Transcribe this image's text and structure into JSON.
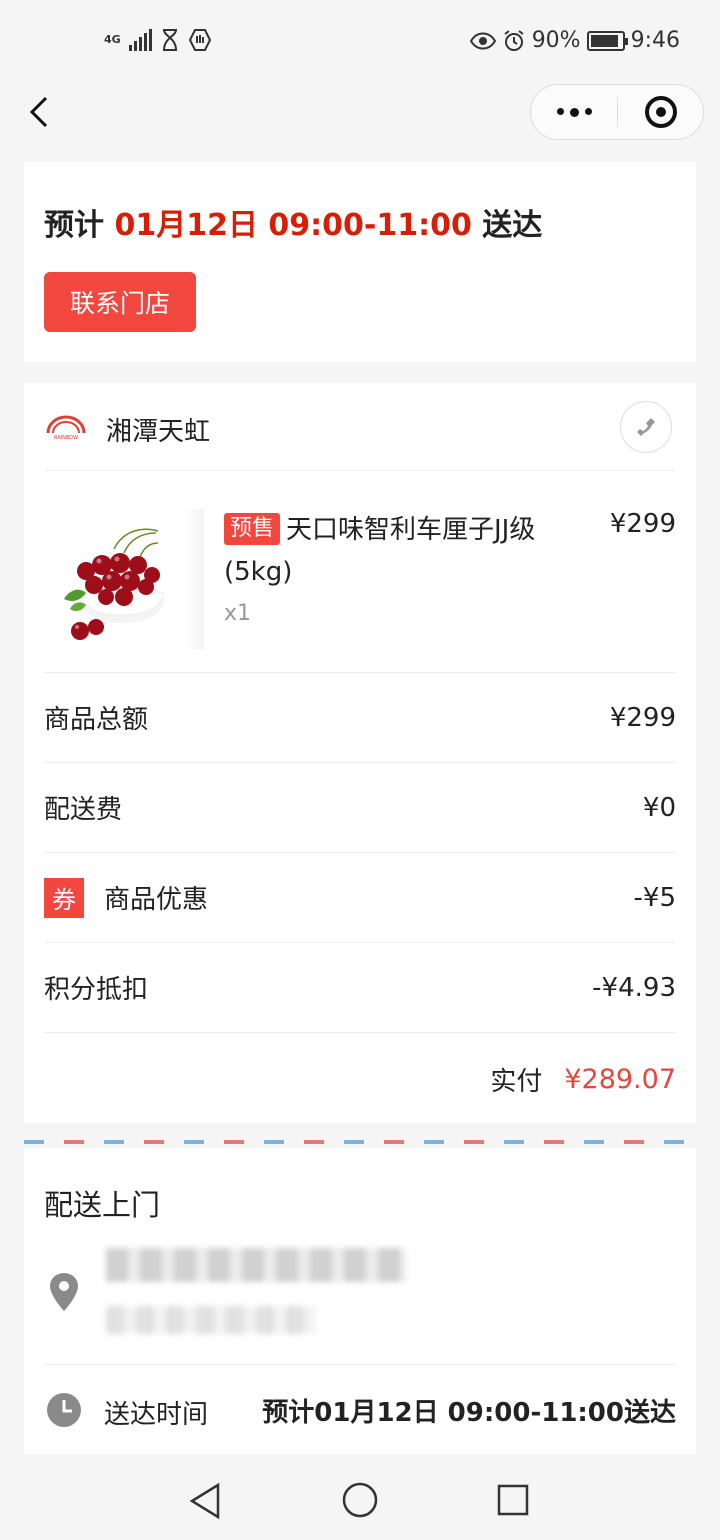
{
  "status": {
    "network": "4G",
    "battery": "90%",
    "time": "9:46"
  },
  "delivery": {
    "prefix": "预计",
    "window": "01月12日 09:00-11:00",
    "suffix": "送达",
    "contact_label": "联系门店"
  },
  "store": {
    "name": "湘潭天虹",
    "logo_text": "RAINBOW"
  },
  "product": {
    "tag": "预售",
    "name": "天口味智利车厘子JJ级(5kg)",
    "qty": "x1",
    "price": "¥299"
  },
  "summary": [
    {
      "label": "商品总额",
      "value": "¥299"
    },
    {
      "label": "配送费",
      "value": "¥0"
    },
    {
      "label": "商品优惠",
      "badge": "券",
      "value": "-¥5"
    },
    {
      "label": "积分抵扣",
      "value": "-¥4.93"
    }
  ],
  "total": {
    "label": "实付",
    "value": "¥289.07"
  },
  "shipping": {
    "title": "配送上门",
    "time_label": "送达时间",
    "time_value": "预计01月12日 09:00-11:00送达"
  },
  "colors": {
    "accent": "#f2473f",
    "price_red": "#e5473f",
    "eta_red": "#d81e06"
  }
}
